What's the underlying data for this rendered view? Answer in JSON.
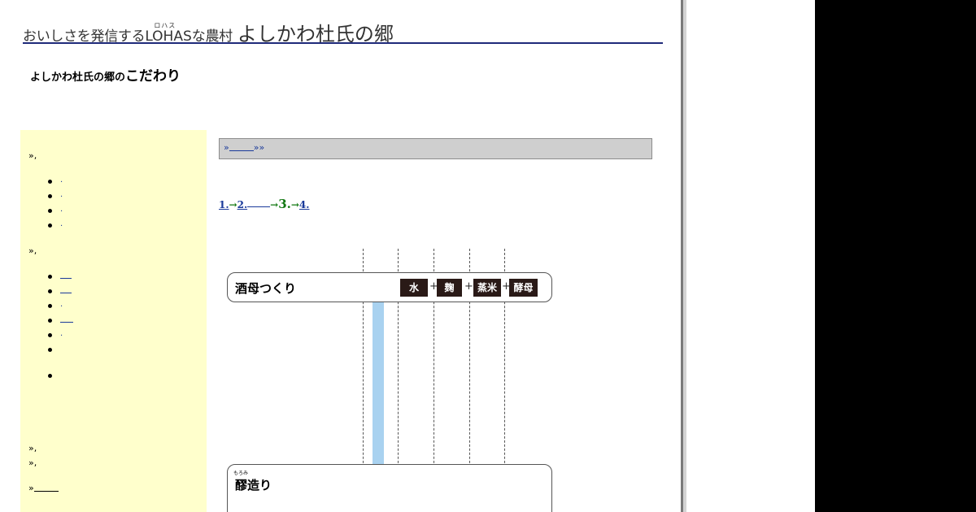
{
  "header": {
    "tagline": "おいしさを発信する",
    "lohas_ruby": "ロハス",
    "lohas": "LOHAS",
    "tagline_suffix": "な農村",
    "site_name": "よしかわ杜氏の郷"
  },
  "subtitle": {
    "part1": "よしかわ杜氏の郷の",
    "part2": "こだわり"
  },
  "sidebar": {
    "section1_marker": "»,",
    "section1_items": [
      ".",
      ".",
      ".",
      "."
    ],
    "section2_marker": "»,",
    "section2_items": [
      "",
      "",
      ".",
      "",
      ".",
      "",
      ""
    ],
    "section3_marker": "»,",
    "section4_marker": "»,",
    "more_marker": "»"
  },
  "nav_bar": {
    "prefix": "»",
    "suffix": "»»"
  },
  "steps": {
    "step1": "1.",
    "arrow1": "→",
    "step2": "2.",
    "arrow2": "→",
    "step3": "3.",
    "arrow3": "→",
    "step4": "4."
  },
  "diagram": {
    "box1_label": "酒母つくり",
    "ingredients": [
      "水",
      "麹",
      "蒸米",
      "酵母"
    ],
    "plus": "+",
    "box2_ruby": "もろみ",
    "box2_label": "醪造り"
  },
  "colors": {
    "title_rule": "#1f2a7a",
    "sidebar_bg": "#ffffcc",
    "nav_bar_bg": "#cfcfcf",
    "link": "#1a3a9a",
    "current_step": "#117711",
    "chip_bg": "#2a1a17",
    "blue_bar": "#a9d2f0"
  }
}
